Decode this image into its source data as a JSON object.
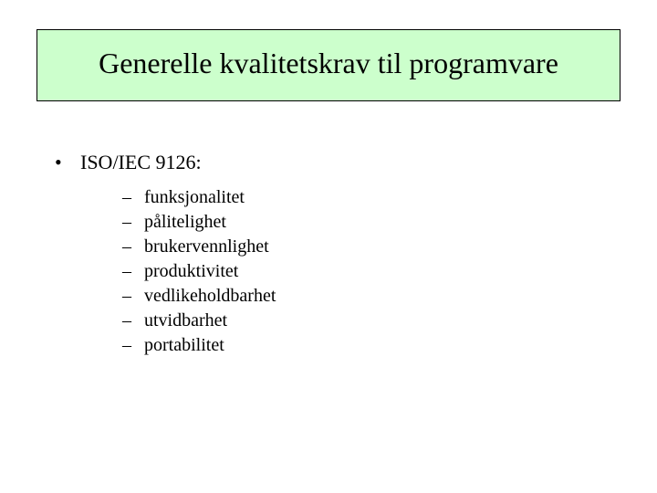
{
  "title": "Generelle kvalitetskrav til programvare",
  "bullet1": {
    "marker": "•",
    "text": "ISO/IEC 9126:"
  },
  "sub": {
    "marker": "–",
    "items": [
      "funksjonalitet",
      "pålitelighet",
      "brukervennlighet",
      "produktivitet",
      "vedlikeholdbarhet",
      "utvidbarhet",
      "portabilitet"
    ]
  }
}
